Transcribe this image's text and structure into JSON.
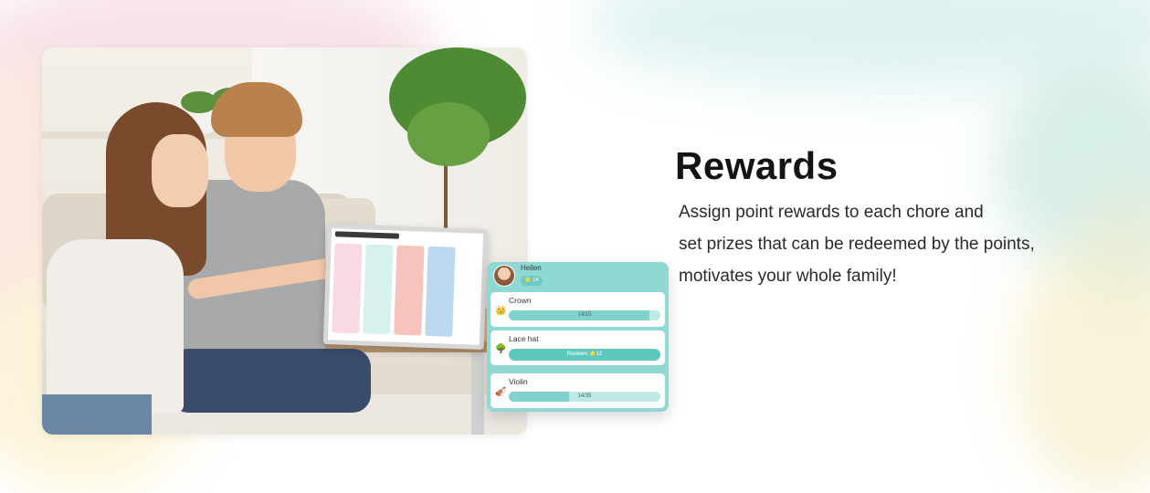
{
  "feature": {
    "title": "Rewards",
    "description_lines": [
      "Assign point rewards to each chore and",
      "set prizes that can be redeemed by the points,",
      "motivates your whole family!"
    ]
  },
  "reward_card": {
    "user_name": "Heilen",
    "points": "14",
    "items": [
      {
        "label": "Crown",
        "icon": "crown-icon",
        "progress_text": "14/15",
        "progress": 0.93
      },
      {
        "label": "Lace hat",
        "icon": "hat-icon",
        "button_text": "Redeem ⭐12"
      },
      {
        "label": "Violin",
        "icon": "violin-icon",
        "progress_text": "14/35",
        "progress": 0.4
      }
    ]
  },
  "colors": {
    "accent": "#8fd8d3",
    "progress_fill": "#7fd3cc",
    "redeem": "#5ec8bf",
    "title": "#141414"
  }
}
